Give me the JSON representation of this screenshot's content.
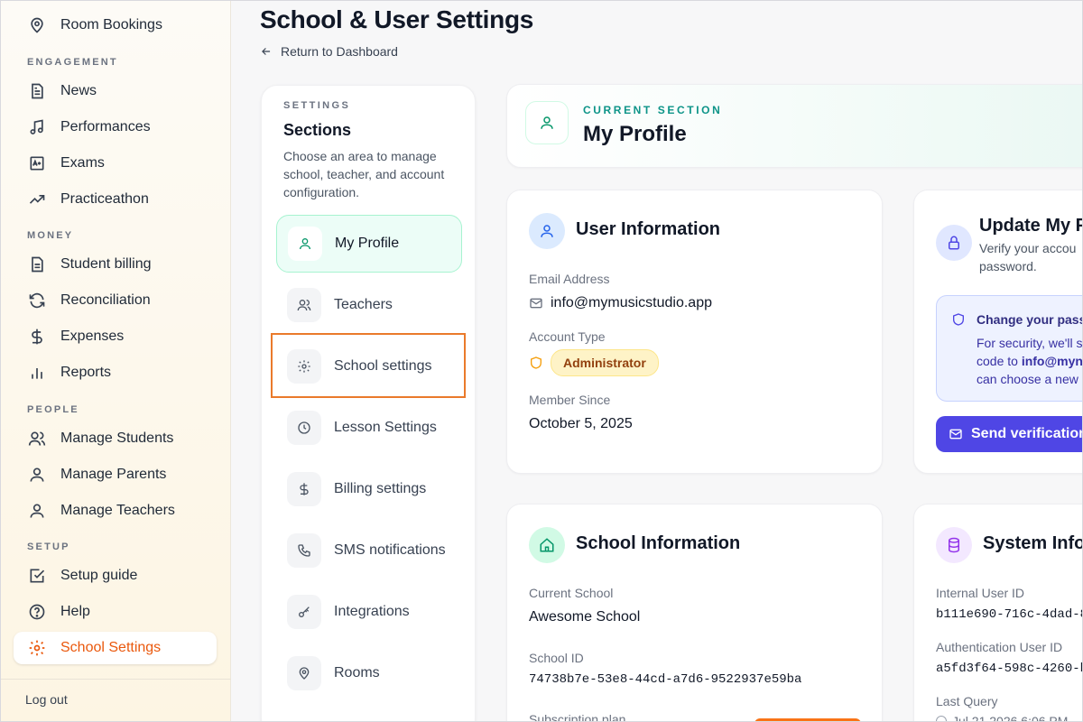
{
  "sidebar": {
    "top_item": {
      "label": "Room Bookings",
      "icon": "map-pin-icon"
    },
    "groups": [
      {
        "heading": "ENGAGEMENT",
        "items": [
          {
            "label": "News",
            "icon": "document-icon"
          },
          {
            "label": "Performances",
            "icon": "music-note-icon"
          },
          {
            "label": "Exams",
            "icon": "grade-icon"
          },
          {
            "label": "Practiceathon",
            "icon": "trending-up-icon"
          }
        ]
      },
      {
        "heading": "MONEY",
        "items": [
          {
            "label": "Student billing",
            "icon": "invoice-icon"
          },
          {
            "label": "Reconciliation",
            "icon": "refresh-icon"
          },
          {
            "label": "Expenses",
            "icon": "dollar-icon"
          },
          {
            "label": "Reports",
            "icon": "bar-chart-icon"
          }
        ]
      },
      {
        "heading": "PEOPLE",
        "items": [
          {
            "label": "Manage Students",
            "icon": "users-icon"
          },
          {
            "label": "Manage Parents",
            "icon": "user-icon"
          },
          {
            "label": "Manage Teachers",
            "icon": "user-icon"
          }
        ]
      },
      {
        "heading": "SETUP",
        "items": [
          {
            "label": "Setup guide",
            "icon": "checkbox-icon"
          },
          {
            "label": "Help",
            "icon": "help-icon"
          },
          {
            "label": "School Settings",
            "icon": "gear-icon",
            "active": true
          }
        ]
      }
    ],
    "logout": "Log out"
  },
  "header": {
    "title": "School & User Settings",
    "back_link": "Return to Dashboard"
  },
  "sections": {
    "eyebrow": "SETTINGS",
    "title": "Sections",
    "description": "Choose an area to manage school, teacher, and account configuration.",
    "items": [
      {
        "label": "My Profile",
        "icon": "user-icon",
        "active": true
      },
      {
        "label": "Teachers",
        "icon": "users-icon"
      },
      {
        "label": "School settings",
        "icon": "gear-icon"
      },
      {
        "label": "Lesson Settings",
        "icon": "clock-icon"
      },
      {
        "label": "Billing settings",
        "icon": "dollar-icon"
      },
      {
        "label": "SMS notifications",
        "icon": "phone-icon"
      },
      {
        "label": "Integrations",
        "icon": "key-icon"
      },
      {
        "label": "Rooms",
        "icon": "map-pin-icon"
      }
    ]
  },
  "current_section": {
    "eyebrow": "CURRENT SECTION",
    "title": "My Profile"
  },
  "user_info": {
    "title": "User Information",
    "email_label": "Email Address",
    "email": "info@mymusicstudio.app",
    "account_type_label": "Account Type",
    "account_type": "Administrator",
    "member_since_label": "Member Since",
    "member_since": "October 5, 2025"
  },
  "update_password": {
    "title": "Update My P",
    "subtitle_line1": "Verify your accou",
    "subtitle_line2": "password.",
    "notice_title": "Change your pass",
    "notice_line1": "For security, we'll s",
    "notice_line2_prefix": "code to ",
    "notice_line2_bold": "info@myn",
    "notice_line3": "can choose a new",
    "send_button": "Send verification"
  },
  "school_info": {
    "title": "School Information",
    "current_school_label": "Current School",
    "current_school": "Awesome School",
    "school_id_label": "School ID",
    "school_id": "74738b7e-53e8-44cd-a7d6-9522937e59ba",
    "subscription_label": "Subscription plan"
  },
  "system_info": {
    "title": "System Infor",
    "internal_id_label": "Internal User ID",
    "internal_id": "b111e690-716c-4dad-8",
    "auth_id_label": "Authentication User ID",
    "auth_id": "a5fd3f64-598c-4260-b",
    "last_query_label": "Last Query",
    "last_query": "Jul 21 2026 6:06 PM"
  },
  "colors": {
    "accent": "#ea580c",
    "brand_green": "#059669",
    "indigo": "#4f46e5"
  }
}
